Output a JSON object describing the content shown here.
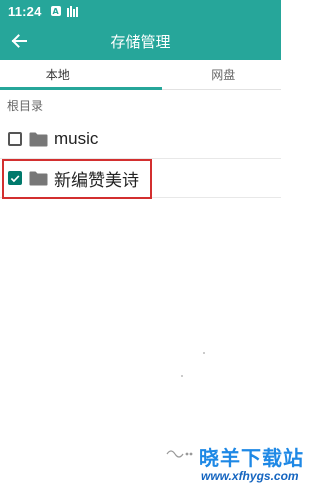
{
  "status_bar": {
    "time": "11:24",
    "icon_a_letter": "A"
  },
  "app_bar": {
    "title": "存储管理"
  },
  "tabs": [
    {
      "label": "本地",
      "selected": true
    },
    {
      "label": "网盘",
      "selected": false
    }
  ],
  "path": {
    "label": "根目录"
  },
  "items": [
    {
      "name": "music",
      "checked": false
    },
    {
      "name": "新编赞美诗",
      "checked": true
    }
  ],
  "watermark": {
    "text": "晓羊下载站",
    "url": "www.xfhygs.com"
  },
  "colors": {
    "accent": "#26a69a",
    "checkbox_checked": "#00796b",
    "highlight": "#d32f2f",
    "watermark": "#1e88e5"
  }
}
